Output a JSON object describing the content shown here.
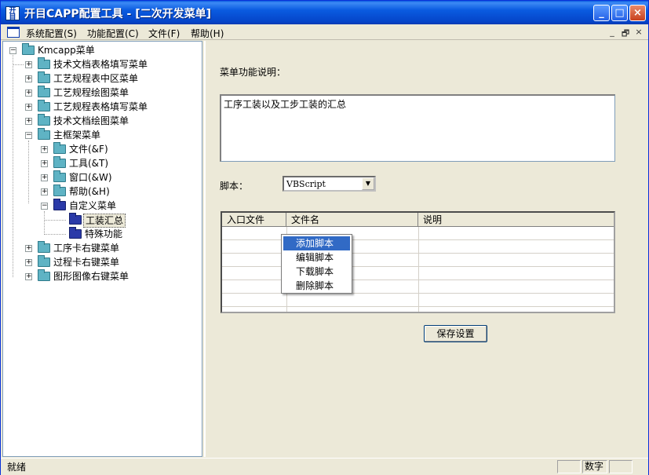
{
  "window": {
    "title": "开目CAPP配置工具 - [二次开发菜单]",
    "icon_text": "开目",
    "controls": [
      "_",
      "□",
      "×"
    ]
  },
  "menubar": {
    "items": [
      "系统配置(S)",
      "功能配置(C)",
      "文件(F)",
      "帮助(H)"
    ],
    "mdi_controls": [
      "_",
      "🗗",
      "×"
    ]
  },
  "tree": {
    "root": "Kmcapp菜单",
    "items": [
      {
        "label": "技术文档表格填写菜单"
      },
      {
        "label": "工艺规程表中区菜单"
      },
      {
        "label": "工艺规程绘图菜单"
      },
      {
        "label": "工艺规程表格填写菜单"
      },
      {
        "label": "技术文档绘图菜单"
      },
      {
        "label": "主框架菜单"
      },
      {
        "label": "文件(&F)"
      },
      {
        "label": "工具(&T)"
      },
      {
        "label": "窗口(&W)"
      },
      {
        "label": "帮助(&H)"
      },
      {
        "label": "自定义菜单"
      },
      {
        "label": "工装汇总"
      },
      {
        "label": "特殊功能"
      },
      {
        "label": "工序卡右键菜单"
      },
      {
        "label": "过程卡右键菜单"
      },
      {
        "label": "图形图像右键菜单"
      }
    ]
  },
  "main": {
    "desc_label": "菜单功能说明：",
    "desc_value": "工序工装以及工步工装的汇总",
    "script_label": "脚本：",
    "script_value": "VBScript",
    "grid_headers": [
      "入口文件",
      "文件名",
      "说明"
    ],
    "save_button": "保存设置"
  },
  "context_menu": {
    "items": [
      "添加脚本",
      "编辑脚本",
      "下载脚本",
      "删除脚本"
    ],
    "highlighted": "添加脚本"
  },
  "statusbar": {
    "text": "就绪",
    "panel_num": "数字"
  }
}
